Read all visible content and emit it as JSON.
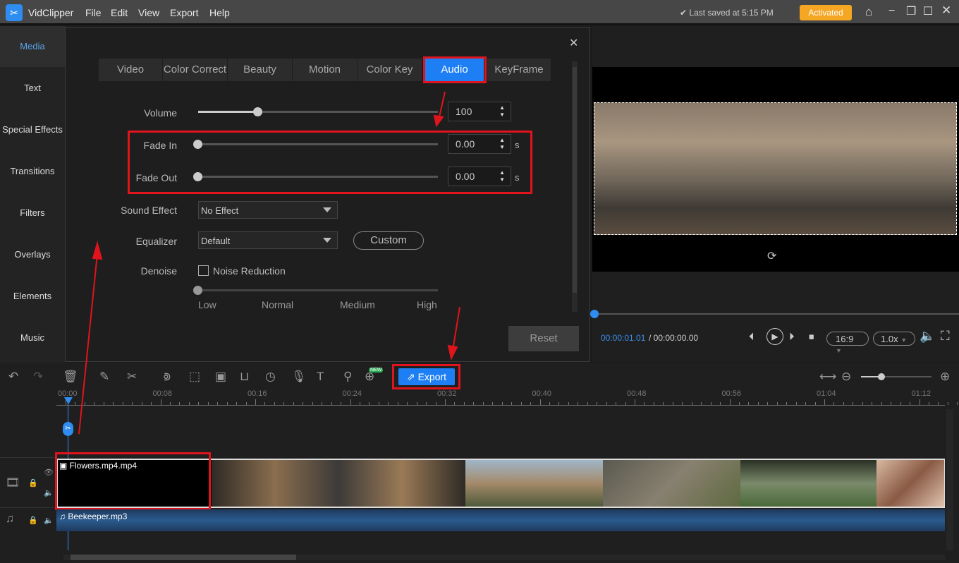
{
  "app": {
    "name": "VidClipper",
    "menu": [
      "File",
      "Edit",
      "View",
      "Export",
      "Help"
    ],
    "saved": "Last saved at 5:15 PM",
    "activated": "Activated"
  },
  "sidebar": {
    "items": [
      "Media",
      "Text",
      "Special Effects",
      "Transitions",
      "Filters",
      "Overlays",
      "Elements",
      "Music"
    ],
    "active": "Media"
  },
  "dialog": {
    "tabs": [
      "Video",
      "Color Correct",
      "Beauty",
      "Motion",
      "Color Key",
      "Audio",
      "KeyFrame"
    ],
    "active_tab": "Audio",
    "volume": {
      "label": "Volume",
      "value": "100",
      "level": 100
    },
    "fade_in": {
      "label": "Fade In",
      "value": "0.00",
      "unit": "s"
    },
    "fade_out": {
      "label": "Fade Out",
      "value": "0.00",
      "unit": "s"
    },
    "sound_effect": {
      "label": "Sound Effect",
      "value": "No Effect"
    },
    "equalizer": {
      "label": "Equalizer",
      "value": "Default",
      "custom": "Custom"
    },
    "denoise": {
      "label": "Denoise",
      "checkbox": "Noise Reduction",
      "checked": false,
      "levels": [
        "Low",
        "Normal",
        "Medium",
        "High"
      ],
      "level": "Low"
    },
    "reset": "Reset"
  },
  "preview": {
    "current_time": "00:00:01.01",
    "total_time": "/ 00:00:00.00",
    "aspect": "16:9",
    "speed": "1.0x"
  },
  "toolbar": {
    "export": "Export",
    "new_badge": "NEW"
  },
  "timeline": {
    "ticks": [
      "00:00",
      "00:08",
      "00:16",
      "00:24",
      "00:32",
      "00:40",
      "00:48",
      "00:56",
      "01:04",
      "01:12"
    ],
    "video_clip": "Flowers.mp4.mp4",
    "audio_clip": "Beekeeper.mp3"
  },
  "colors": {
    "accent": "#1e7ff5",
    "highlight": "#e0141c",
    "activated": "#f5a623"
  }
}
